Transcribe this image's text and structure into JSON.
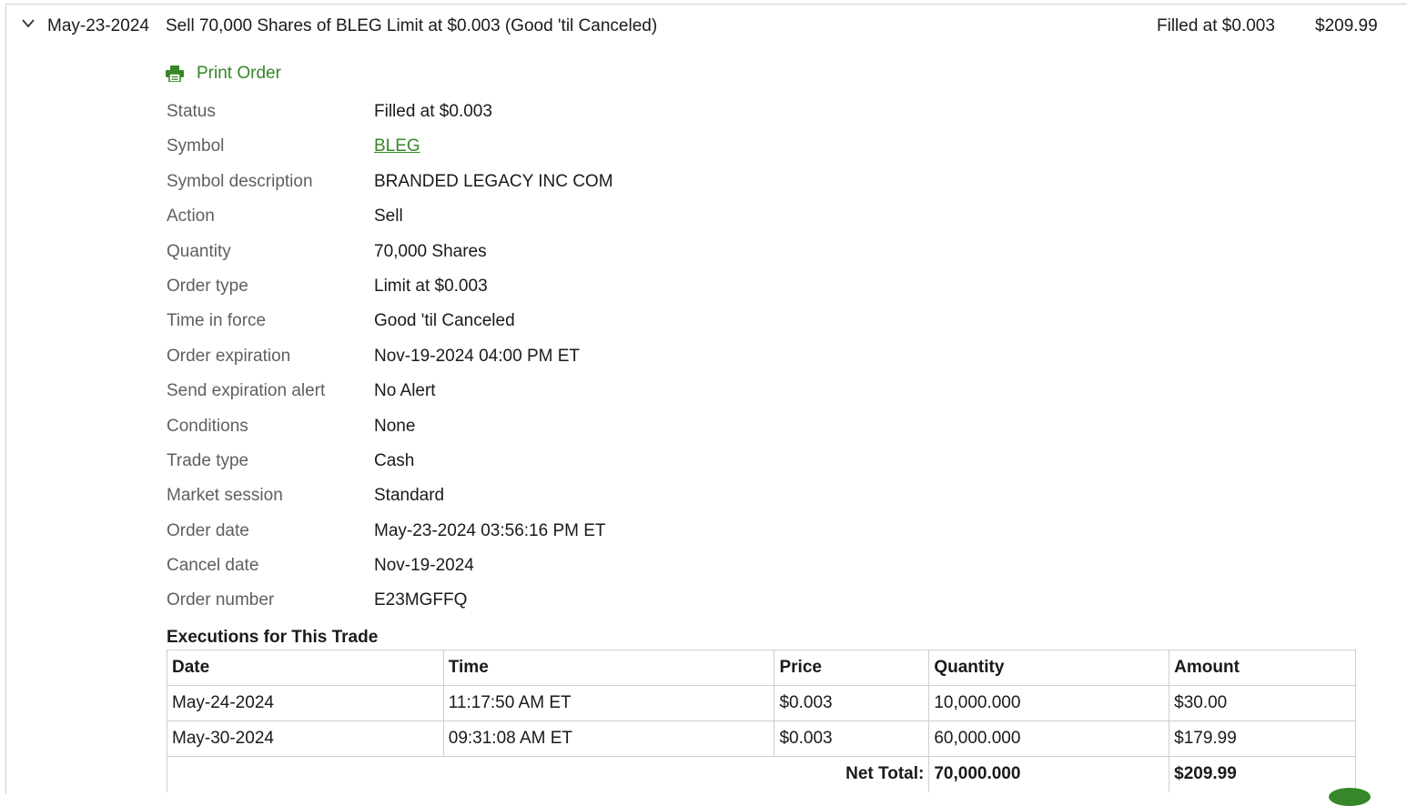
{
  "header": {
    "date": "May-23-2024",
    "description": "Sell 70,000 Shares of BLEG Limit at $0.003 (Good 'til Canceled)",
    "status": "Filled at $0.003",
    "amount": "$209.99"
  },
  "print_order_label": "Print Order",
  "details": {
    "status": {
      "label": "Status",
      "value": "Filled at $0.003"
    },
    "symbol": {
      "label": "Symbol",
      "value": "BLEG"
    },
    "symbol_description": {
      "label": "Symbol description",
      "value": "BRANDED LEGACY INC COM"
    },
    "action": {
      "label": "Action",
      "value": "Sell"
    },
    "quantity": {
      "label": "Quantity",
      "value": "70,000 Shares"
    },
    "order_type": {
      "label": "Order type",
      "value": "Limit at $0.003"
    },
    "time_in_force": {
      "label": "Time in force",
      "value": "Good 'til Canceled"
    },
    "order_expiration": {
      "label": "Order expiration",
      "value": "Nov-19-2024 04:00 PM ET"
    },
    "send_expiration_alert": {
      "label": "Send expiration alert",
      "value": "No Alert"
    },
    "conditions": {
      "label": "Conditions",
      "value": "None"
    },
    "trade_type": {
      "label": "Trade type",
      "value": "Cash"
    },
    "market_session": {
      "label": "Market session",
      "value": "Standard"
    },
    "order_date": {
      "label": "Order date",
      "value": "May-23-2024 03:56:16 PM ET"
    },
    "cancel_date": {
      "label": "Cancel date",
      "value": "Nov-19-2024"
    },
    "order_number": {
      "label": "Order number",
      "value": "E23MGFFQ"
    }
  },
  "executions": {
    "title": "Executions for This Trade",
    "columns": [
      "Date",
      "Time",
      "Price",
      "Quantity",
      "Amount"
    ],
    "rows": [
      [
        "May-24-2024",
        "11:17:50 AM ET",
        "$0.003",
        "10,000.000",
        "$30.00"
      ],
      [
        "May-30-2024",
        "09:31:08 AM ET",
        "$0.003",
        "60,000.000",
        "$179.99"
      ]
    ],
    "net_total_label": "Net Total:",
    "net_total_quantity": "70,000.000",
    "net_total_amount": "$209.99"
  },
  "colors": {
    "accent": "#368727",
    "label": "#5f5f5f",
    "text": "#1a1a1a",
    "border": "#cfcfcf"
  },
  "icons": {
    "expand": "chevron-down-icon",
    "print": "printer-icon"
  }
}
